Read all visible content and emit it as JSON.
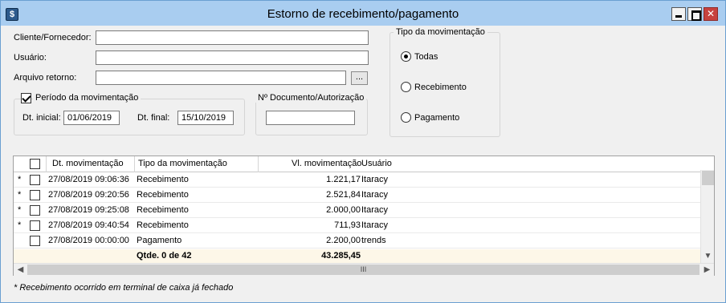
{
  "window": {
    "title": "Estorno de recebimento/pagamento",
    "controls": [
      "minimize-icon",
      "maximize-icon",
      "close-icon"
    ]
  },
  "form": {
    "cliente_label": "Cliente/Fornecedor:",
    "cliente_value": "",
    "usuario_label": "Usuário:",
    "usuario_value": "",
    "arquivo_label": "Arquivo retorno:",
    "arquivo_value": "",
    "browse_label": "...",
    "periodo": {
      "label": "Período da movimentação",
      "checked": true,
      "inicial_label": "Dt. inicial:",
      "inicial_value": "01/06/2019",
      "final_label": "Dt. final:",
      "final_value": "15/10/2019"
    },
    "documento_label": "Nº Documento/Autorização",
    "documento_value": ""
  },
  "tipo": {
    "title": "Tipo da movimentação",
    "options": [
      {
        "label": "Todas",
        "selected": true
      },
      {
        "label": "Recebimento",
        "selected": false
      },
      {
        "label": "Pagamento",
        "selected": false
      }
    ]
  },
  "grid": {
    "columns": [
      "Dt. movimentação",
      "Tipo da movimentação",
      "Vl. movimentação",
      "Usuário"
    ],
    "rows": [
      {
        "marker": "*",
        "date": "27/08/2019 09:06:36",
        "tipo": "Recebimento",
        "valor": "1.221,17",
        "usuario": "Itaracy"
      },
      {
        "marker": "*",
        "date": "27/08/2019 09:20:56",
        "tipo": "Recebimento",
        "valor": "2.521,84",
        "usuario": "Itaracy"
      },
      {
        "marker": "*",
        "date": "27/08/2019 09:25:08",
        "tipo": "Recebimento",
        "valor": "2.000,00",
        "usuario": "Itaracy"
      },
      {
        "marker": "*",
        "date": "27/08/2019 09:40:54",
        "tipo": "Recebimento",
        "valor": "711,93",
        "usuario": "Itaracy"
      },
      {
        "marker": "",
        "date": "27/08/2019 00:00:00",
        "tipo": "Pagamento",
        "valor": "2.200,00",
        "usuario": "trends"
      }
    ],
    "total_qtde": "Qtde. 0 de 42",
    "total_valor": "43.285,45",
    "scroll_grip": "III"
  },
  "footnote": "* Recebimento ocorrido em terminal de caixa já fechado"
}
